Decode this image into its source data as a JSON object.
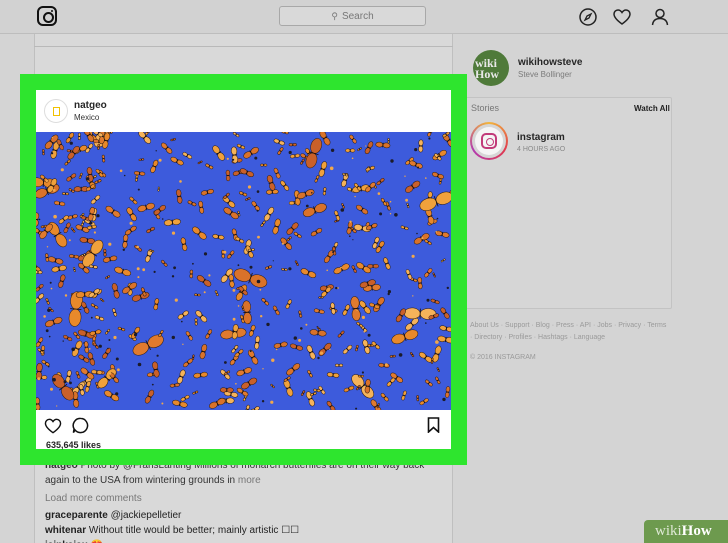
{
  "search": {
    "placeholder": "Search"
  },
  "sidebar": {
    "username": "wikihowsteve",
    "fullname": "Steve Bollinger",
    "avatar_text": "wiki\nHow",
    "stories_label": "Stories",
    "watch_all": "Watch All",
    "story": {
      "name": "instagram",
      "time": "4 HOURS AGO"
    },
    "footer_links": "About Us · Support · Blog · Press · API · Jobs · Privacy · Terms · Directory · Profiles · Hashtags · Language",
    "copyright": "© 2016 INSTAGRAM"
  },
  "post": {
    "username": "natgeo",
    "location": "Mexico",
    "likes": "635,645 likes"
  },
  "comments": {
    "caption_user": "natgeo",
    "caption_text": "Photo by @FransLanting Millions of monarch butterflies are on their way back again to the USA from wintering grounds in",
    "caption_more": "more",
    "load_more": "Load more comments",
    "items": [
      {
        "user": "graceparente",
        "text": "@jackiepelletier"
      },
      {
        "user": "whitenar",
        "text": "Without title would be better; mainly artistic ☐☐"
      },
      {
        "user": "jainkajau",
        "text": "😍"
      }
    ]
  },
  "watermark": {
    "part1": "wiki",
    "part2": "How"
  },
  "colors": {
    "highlight": "#2ee52e",
    "sky": "#3d5bdc",
    "monarch": "#e8892b"
  }
}
